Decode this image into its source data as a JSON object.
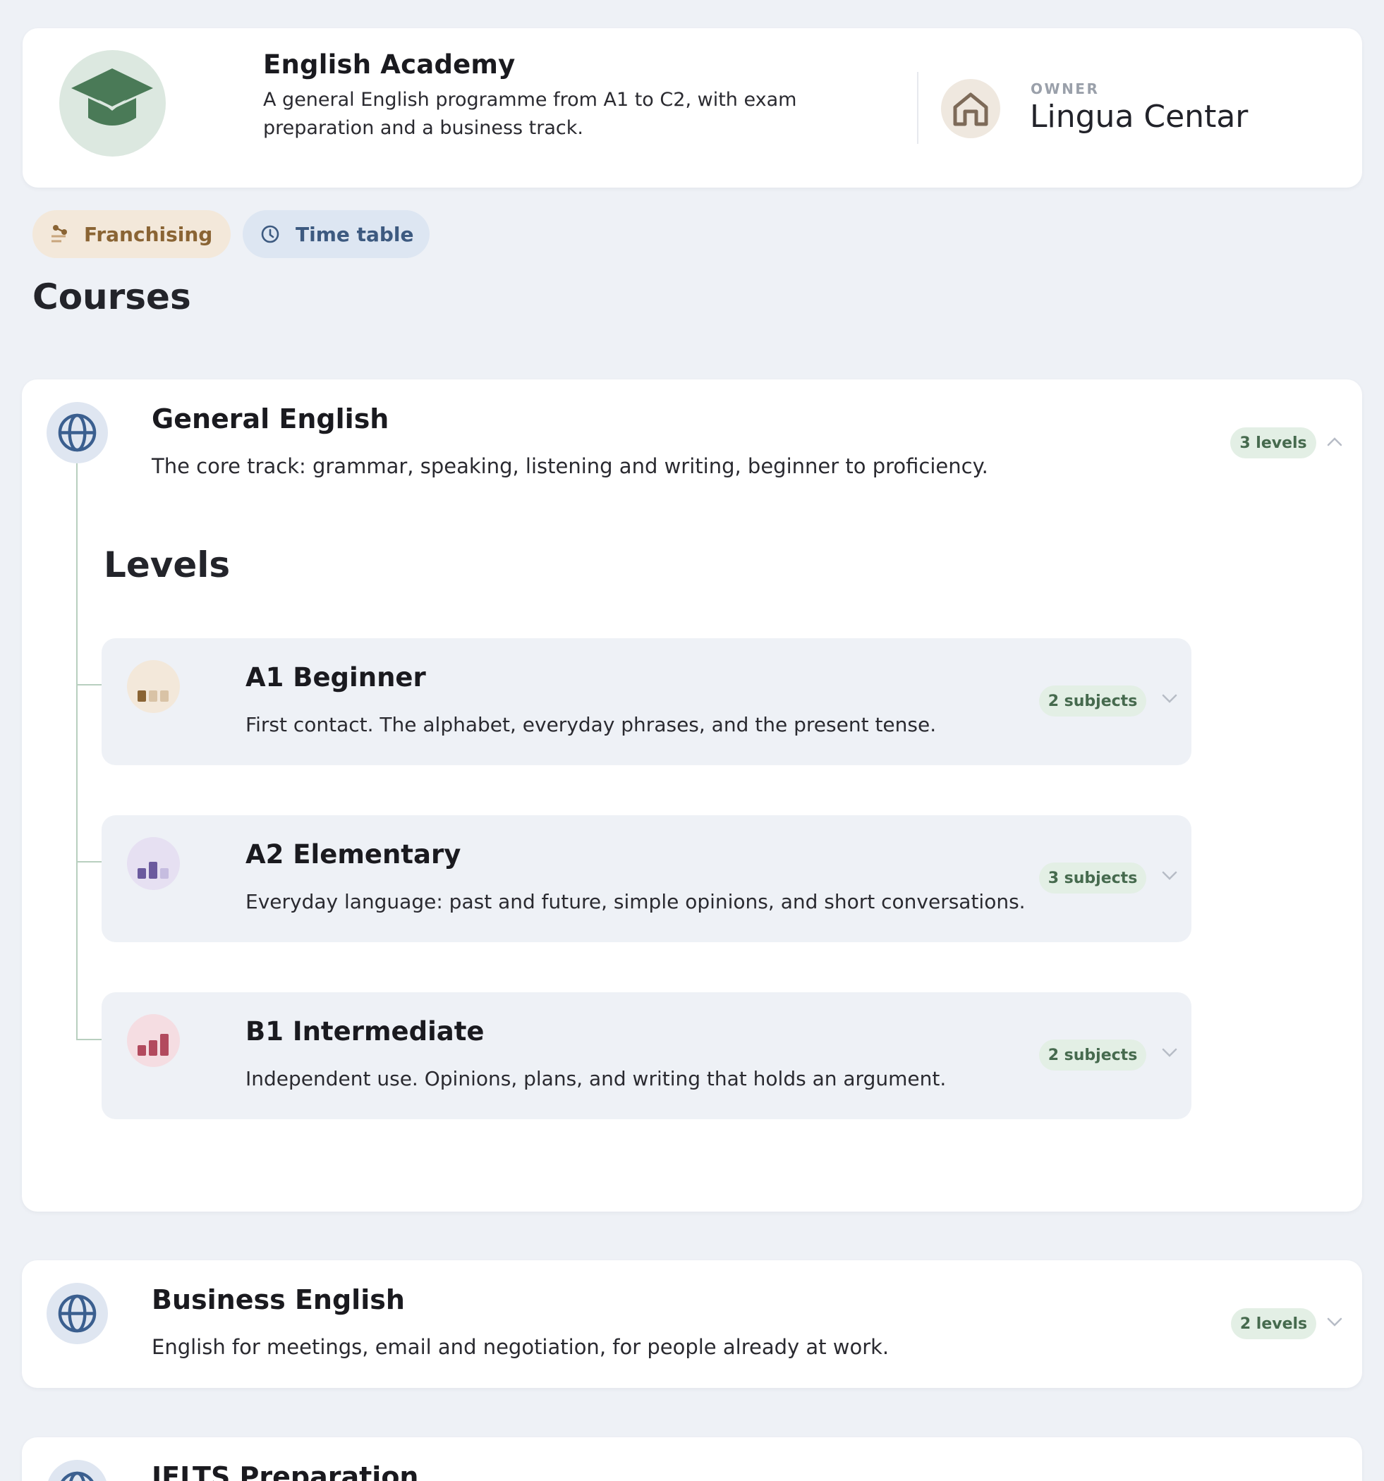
{
  "academy": {
    "title": "English Academy",
    "description": "A general English programme from A1 to C2, with exam preparation and a business track.",
    "icon": "graduation-cap-icon",
    "accent": "#4a7a57"
  },
  "owner": {
    "label": "OWNER",
    "name": "Lingua Centar",
    "icon": "home-icon"
  },
  "actions": {
    "franchising_label": "Franchising",
    "timetable_label": "Time table"
  },
  "courses_heading": "Courses",
  "courses": [
    {
      "title": "General English",
      "description": "The core track: grammar, speaking, listening and writing, beginner to proficiency.",
      "count_label": "3 levels",
      "expanded": true,
      "levels_heading": "Levels",
      "levels": [
        {
          "title": "A1 Beginner",
          "description": "First contact. The alphabet, everyday phrases, and the present tense.",
          "count_label": "2 subjects",
          "icon_color": "#8a6434"
        },
        {
          "title": "A2 Elementary",
          "description": "Everyday language: past and future, simple opinions, and short conversations.",
          "count_label": "3 subjects",
          "icon_color": "#6b5a9e"
        },
        {
          "title": "B1 Intermediate",
          "description": "Independent use. Opinions, plans, and writing that holds an argument.",
          "count_label": "2 subjects",
          "icon_color": "#b24a5e"
        }
      ]
    },
    {
      "title": "Business English",
      "description": "English for meetings, email and negotiation, for people already at work.",
      "count_label": "2 levels",
      "expanded": false
    },
    {
      "title": "IELTS Preparation"
    }
  ]
}
